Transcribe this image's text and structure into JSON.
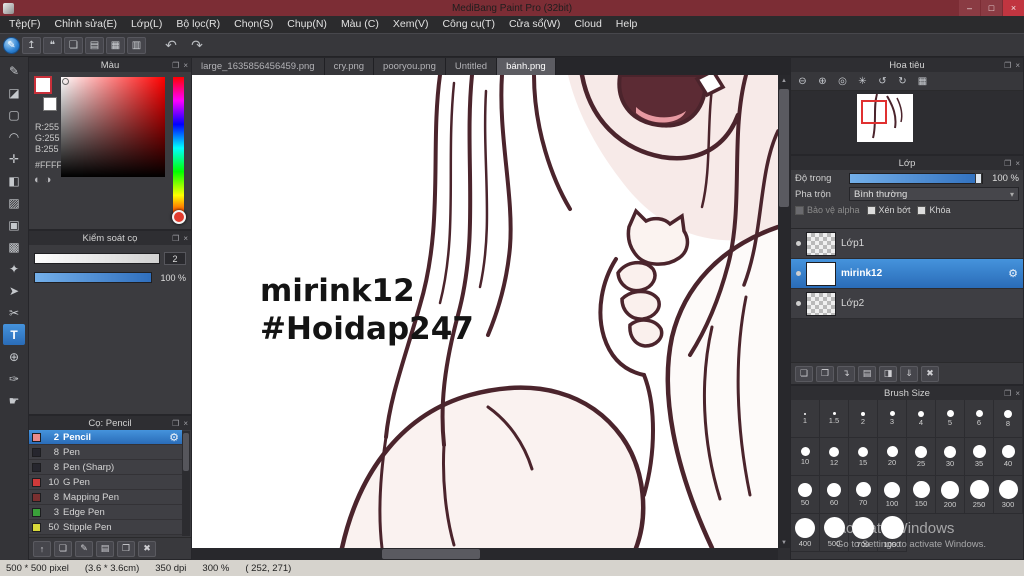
{
  "window": {
    "title": "MediBang Paint Pro (32bit)",
    "minimize_icon": "–",
    "maximize_icon": "□",
    "close_icon": "×"
  },
  "ui": {
    "popout_icon": "❐",
    "close_icon": "×",
    "dropdown_arrow": "▾",
    "scroll_up": "▲",
    "scroll_down": "▼",
    "gear_icon": "⚙"
  },
  "menu_items": [
    "Tệp(F)",
    "Chỉnh sửa(E)",
    "Lớp(L)",
    "Bộ lọc(R)",
    "Chọn(S)",
    "Chụp(N)",
    "Màu (C)",
    "Xem(V)",
    "Công cụ(T)",
    "Cửa sổ(W)",
    "Cloud",
    "Help"
  ],
  "toolbar": {
    "icons": [
      {
        "name": "medibang-cloud-icon",
        "glyph": "✎",
        "blue": true
      },
      {
        "name": "upload-icon",
        "glyph": "↥"
      },
      {
        "name": "comment-icon",
        "glyph": "❝"
      },
      {
        "name": "new-canvas-icon",
        "glyph": "❏"
      },
      {
        "name": "open-file-icon",
        "glyph": "▤"
      },
      {
        "name": "grid-view-icon",
        "glyph": "▦"
      },
      {
        "name": "panel-layout-icon",
        "glyph": "▥"
      }
    ],
    "undo_icon": "↶",
    "redo_icon": "↷"
  },
  "tools": [
    {
      "name": "brush-tool",
      "glyph": "✎"
    },
    {
      "name": "eraser-tool",
      "glyph": "◪"
    },
    {
      "name": "marquee-select-tool",
      "glyph": "▢"
    },
    {
      "name": "lasso-select-tool",
      "glyph": "◠"
    },
    {
      "name": "move-tool",
      "glyph": "✛"
    },
    {
      "name": "bucket-fill-tool",
      "glyph": "◧"
    },
    {
      "name": "gradient-tool",
      "glyph": "▨"
    },
    {
      "name": "select-pen-tool",
      "glyph": "▣"
    },
    {
      "name": "select-eraser-tool",
      "glyph": "▩"
    },
    {
      "name": "magic-wand-tool",
      "glyph": "✦"
    },
    {
      "name": "operation-tool",
      "glyph": "➤"
    },
    {
      "name": "divide-tool",
      "glyph": "✂"
    },
    {
      "name": "text-tool",
      "glyph": "T",
      "selected": true
    },
    {
      "name": "zoom-tool",
      "glyph": "⊕"
    },
    {
      "name": "eyedropper-tool",
      "glyph": "✑"
    },
    {
      "name": "hand-tool",
      "glyph": "☛"
    }
  ],
  "color_panel": {
    "title": "Màu",
    "r_label": "R:255",
    "g_label": "G:255",
    "b_label": "B:255",
    "hex": "#FFFFFF",
    "wheel_icon": "◐",
    "palette_icon": "◑"
  },
  "brush_control": {
    "title": "Kiểm soát cọ",
    "size_value": "2",
    "opacity_value": "100 %"
  },
  "brush_panel": {
    "title": "Cọ: Pencil",
    "brushes": [
      {
        "size": "2",
        "name": "Pencil",
        "chip": "#e98a8a",
        "selected": true
      },
      {
        "size": "8",
        "name": "Pen",
        "chip": "#26262e"
      },
      {
        "size": "8",
        "name": "Pen (Sharp)",
        "chip": "#26262e"
      },
      {
        "size": "10",
        "name": "G Pen",
        "chip": "#d03a3a"
      },
      {
        "size": "8",
        "name": "Mapping Pen",
        "chip": "#7a3030"
      },
      {
        "size": "3",
        "name": "Edge Pen",
        "chip": "#3aa03a"
      },
      {
        "size": "50",
        "name": "Stipple Pen",
        "chip": "#d8d83a"
      }
    ],
    "footer_icons": [
      {
        "name": "move-brush-up-icon",
        "glyph": "↑"
      },
      {
        "name": "add-brush-icon",
        "glyph": "❏"
      },
      {
        "name": "edit-brush-icon",
        "glyph": "✎"
      },
      {
        "name": "brush-folder-icon",
        "glyph": "▤"
      },
      {
        "name": "duplicate-brush-icon",
        "glyph": "❐"
      },
      {
        "name": "delete-brush-icon",
        "glyph": "✖"
      }
    ]
  },
  "canvas": {
    "tabs": [
      "large_1635856456459.png",
      "cry.png",
      "pooryou.png",
      "Untitled",
      "bánh.png"
    ],
    "active_tab_index": 4,
    "text_line1": "mirink12",
    "text_line2": "#Hoidap247"
  },
  "navigator": {
    "title": "Hoa tiêu",
    "icons": [
      {
        "name": "zoom-out-icon",
        "glyph": "⊖"
      },
      {
        "name": "zoom-in-icon",
        "glyph": "⊕"
      },
      {
        "name": "zoom-fit-icon",
        "glyph": "◎"
      },
      {
        "name": "zoom-reset-icon",
        "glyph": "✳"
      },
      {
        "name": "rotate-left-icon",
        "glyph": "↺"
      },
      {
        "name": "rotate-right-icon",
        "glyph": "↻"
      },
      {
        "name": "reset-view-icon",
        "glyph": "▦"
      }
    ]
  },
  "layer_panel": {
    "title": "Lớp",
    "opacity_label": "Độ trong",
    "opacity_value": "100 %",
    "blend_label": "Pha trộn",
    "blend_value": "Bình thường",
    "alpha_lock_label": "Bảo vệ alpha",
    "clip_label": "Xén bớt",
    "lock_label": "Khóa",
    "layers": [
      {
        "name": "Lớp1",
        "thumb": "checker"
      },
      {
        "name": "mirink12",
        "thumb": "art",
        "selected": true
      },
      {
        "name": "Lớp2",
        "thumb": "checker"
      }
    ],
    "footer_icons": [
      {
        "name": "add-layer-icon",
        "glyph": "❏"
      },
      {
        "name": "duplicate-layer-icon",
        "glyph": "❐"
      },
      {
        "name": "transfer-layer-icon",
        "glyph": "↴"
      },
      {
        "name": "layer-folder-icon",
        "glyph": "▤"
      },
      {
        "name": "clipping-layer-icon",
        "glyph": "◨"
      },
      {
        "name": "merge-layer-icon",
        "glyph": "⇓"
      },
      {
        "name": "delete-layer-icon",
        "glyph": "✖"
      }
    ]
  },
  "brush_size_panel": {
    "title": "Brush Size",
    "sizes": [
      1,
      1.5,
      2,
      3,
      4,
      5,
      6,
      8,
      10,
      12,
      15,
      20,
      25,
      30,
      35,
      40,
      50,
      60,
      70,
      100,
      150,
      200,
      250,
      300,
      400,
      500,
      700,
      1000
    ]
  },
  "status_bar": {
    "dimensions": "500 * 500 pixel",
    "physical": "(3.6 * 3.6cm)",
    "dpi": "350 dpi",
    "zoom": "300 %",
    "cursor": "( 252, 271)"
  },
  "watermark": {
    "line1": "Activate Windows",
    "line2": "Go to Settings to activate Windows."
  },
  "colors": {
    "titlebar": "#7c2d35",
    "accent_blue": "#2f7fd0",
    "line_art": "#4b242c",
    "selected_hue": "#ff0000"
  }
}
